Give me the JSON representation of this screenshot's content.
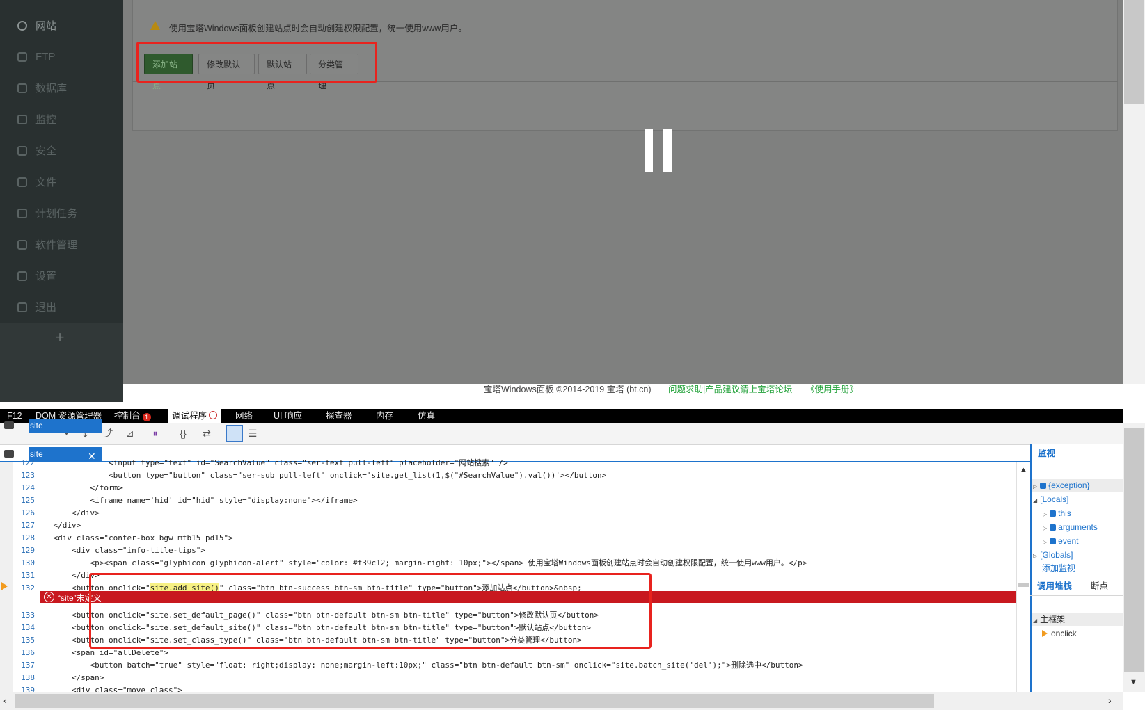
{
  "sidebar": {
    "items": [
      {
        "label": "网站",
        "icon": "globe-icon",
        "active": true
      },
      {
        "label": "FTP",
        "icon": "user-icon"
      },
      {
        "label": "数据库",
        "icon": "database-icon"
      },
      {
        "label": "监控",
        "icon": "monitor-icon"
      },
      {
        "label": "安全",
        "icon": "shield-icon"
      },
      {
        "label": "文件",
        "icon": "folder-icon"
      },
      {
        "label": "计划任务",
        "icon": "calendar-icon"
      },
      {
        "label": "软件管理",
        "icon": "grid-icon"
      },
      {
        "label": "设置",
        "icon": "gear-icon"
      },
      {
        "label": "退出",
        "icon": "logout-icon"
      }
    ],
    "add_label": "+"
  },
  "site_page": {
    "notice": "使用宝塔Windows面板创建站点时会自动创建权限配置，统一使用www用户。",
    "buttons": {
      "add_site": "添加站点",
      "default_page": "修改默认页",
      "default_site": "默认站点",
      "class_manage": "分类管理"
    },
    "footer": {
      "copyright": "宝塔Windows面板 ©2014-2019 宝塔 (bt.cn)",
      "forum": "问题求助|产品建议请上宝塔论坛",
      "manual": "《使用手册》"
    }
  },
  "devtools": {
    "tabs": [
      "F12",
      "DOM 资源管理器",
      "控制台",
      "调试程序",
      "网络",
      "UI 响应",
      "探查器",
      "内存",
      "仿真"
    ],
    "console_error_count": "1",
    "file_tabs": [
      "site",
      "site"
    ],
    "close_glyph": "✕",
    "error_icon": "✕",
    "error_message": "“site”未定义",
    "code_lines": [
      {
        "num": "122",
        "code": "                <input type=\"text\" id=\"SearchValue\" class=\"ser-text pull-left\" placeholder=\"网站搜索\" />"
      },
      {
        "num": "123",
        "code": "                <button type=\"button\" class=\"ser-sub pull-left\" onclick='site.get_list(1,$(\"#SearchValue\").val())'></button>"
      },
      {
        "num": "124",
        "code": "            </form>"
      },
      {
        "num": "125",
        "code": "            <iframe name='hid' id=\"hid\" style=\"display:none\"></iframe>"
      },
      {
        "num": "126",
        "code": "        </div>"
      },
      {
        "num": "127",
        "code": "    </div>"
      },
      {
        "num": "128",
        "code": "    <div class=\"conter-box bgw mtb15 pd15\">"
      },
      {
        "num": "129",
        "code": "        <div class=\"info-title-tips\">"
      },
      {
        "num": "130",
        "code": "            <p><span class=\"glyphicon glyphicon-alert\" style=\"color: #f39c12; margin-right: 10px;\"></span> 使用宝塔Windows面板创建站点时会自动创建权限配置，统一使用www用户。</p>"
      },
      {
        "num": "131",
        "code": "        </div>"
      },
      {
        "num": "132",
        "code_pre": "        <button onclick=\"",
        "code_hl": "site.add_site()",
        "code_post": "\" class=\"btn btn-success btn-sm btn-title\" type=\"button\">添加站点</button>&nbsp;"
      },
      {
        "num": "133",
        "code": "        <button onclick=\"site.set_default_page()\" class=\"btn btn-default btn-sm btn-title\" type=\"button\">修改默认页</button>"
      },
      {
        "num": "134",
        "code": "        <button onclick=\"site.set_default_site()\" class=\"btn btn-default btn-sm btn-title\" type=\"button\">默认站点</button>"
      },
      {
        "num": "135",
        "code": "        <button onclick=\"site.set_class_type()\" class=\"btn btn-default btn-sm btn-title\" type=\"button\">分类管理</button>"
      },
      {
        "num": "136",
        "code": "        <span id=\"allDelete\">"
      },
      {
        "num": "137",
        "code": "            <button batch=\"true\" style=\"float: right;display: none;margin-left:10px;\" class=\"btn btn-default btn-sm\" onclick=\"site.batch_site('del');\">删除选中</button>"
      },
      {
        "num": "138",
        "code": "        </span>"
      },
      {
        "num": "139",
        "code": "        <div class=\"move_class\">"
      }
    ],
    "watch": {
      "title": "监视",
      "items": [
        "{exception}",
        "[Locals]",
        "this",
        "arguments",
        "event",
        "[Globals]"
      ],
      "add": "添加监视"
    },
    "callstack": {
      "tab": "调用堆栈",
      "tab2": "断点",
      "frame": "主框架",
      "entry": "onclick"
    }
  },
  "colors": {
    "accent": "#1e73cc",
    "error": "#c8181f",
    "highlight_box": "#e8231e",
    "success": "#2f5a2d"
  }
}
